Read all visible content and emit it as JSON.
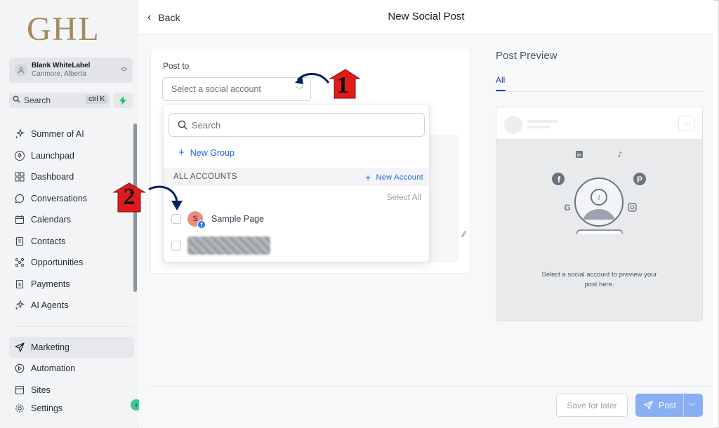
{
  "logo": "GHL",
  "account": {
    "name": "Blank WhiteLabel",
    "location": "Canmore, Alberta"
  },
  "search": {
    "label": "Search",
    "shortcut": "ctrl K"
  },
  "nav": [
    {
      "label": "Summer of AI",
      "icon": "sparkle-icon"
    },
    {
      "label": "Launchpad",
      "icon": "rocket-icon"
    },
    {
      "label": "Dashboard",
      "icon": "grid-icon"
    },
    {
      "label": "Conversations",
      "icon": "chat-icon"
    },
    {
      "label": "Calendars",
      "icon": "calendar-icon"
    },
    {
      "label": "Contacts",
      "icon": "contact-book-icon"
    },
    {
      "label": "Opportunities",
      "icon": "pipeline-icon"
    },
    {
      "label": "Payments",
      "icon": "dollar-doc-icon"
    },
    {
      "label": "AI Agents",
      "icon": "sparkle-icon"
    }
  ],
  "nav2": [
    {
      "label": "Marketing",
      "icon": "send-icon",
      "active": true
    },
    {
      "label": "Automation",
      "icon": "play-circle-icon"
    },
    {
      "label": "Sites",
      "icon": "globe-icon"
    },
    {
      "label": "Settings",
      "icon": "gear-icon"
    }
  ],
  "header": {
    "back": "Back",
    "title": "New Social Post"
  },
  "post": {
    "post_to_label": "Post to",
    "select_placeholder": "Select a social account"
  },
  "dropdown": {
    "search_placeholder": "Search",
    "new_group": "New Group",
    "section": "ALL ACCOUNTS",
    "new_account": "New Account",
    "select_all": "Select All",
    "accounts": [
      {
        "name": "Sample Page",
        "initial": "S",
        "platform": "facebook"
      }
    ]
  },
  "preview": {
    "title": "Post Preview",
    "tab": "All",
    "empty_text": "Select a social account to preview your post here."
  },
  "footer": {
    "save_later": "Save for later",
    "post": "Post"
  },
  "annotations": {
    "step1": "1",
    "step2": "2"
  },
  "colors": {
    "accent": "#2563eb",
    "post_button": "#89aef3",
    "annotation": "#e01b1b",
    "arrow": "#0a1f63"
  }
}
